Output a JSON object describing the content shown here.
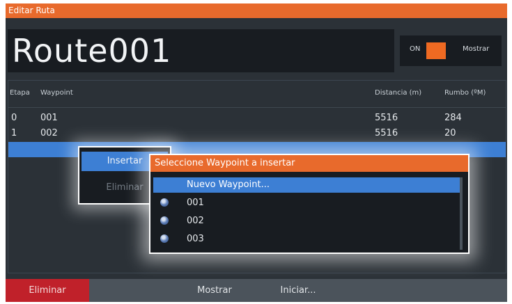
{
  "title_bar": "Editar Ruta",
  "route_name": "Route001",
  "show_toggle": {
    "state_label": "ON",
    "label": "Mostrar",
    "on": true
  },
  "table": {
    "headers": {
      "leg": "Etapa",
      "waypoint": "Waypoint",
      "distance": "Distancia (m)",
      "bearing": "Rumbo (ºM)"
    },
    "rows": [
      {
        "leg": "0",
        "waypoint": "001",
        "distance": "5516",
        "bearing": "284"
      },
      {
        "leg": "1",
        "waypoint": "002",
        "distance": "5516",
        "bearing": "20"
      }
    ]
  },
  "context_menu": {
    "insert": "Insertar",
    "delete": "Eliminar"
  },
  "waypoint_dialog": {
    "title": "Seleccione Waypoint a insertar",
    "new_item": "Nuevo Waypoint...",
    "items": [
      "001",
      "002",
      "003"
    ]
  },
  "bottom_bar": {
    "delete": "Eliminar",
    "show": "Mostrar",
    "start": "Iniciar..."
  },
  "colors": {
    "accent": "#e86a2c",
    "selection": "#3d7fd4",
    "danger": "#c0212a"
  }
}
